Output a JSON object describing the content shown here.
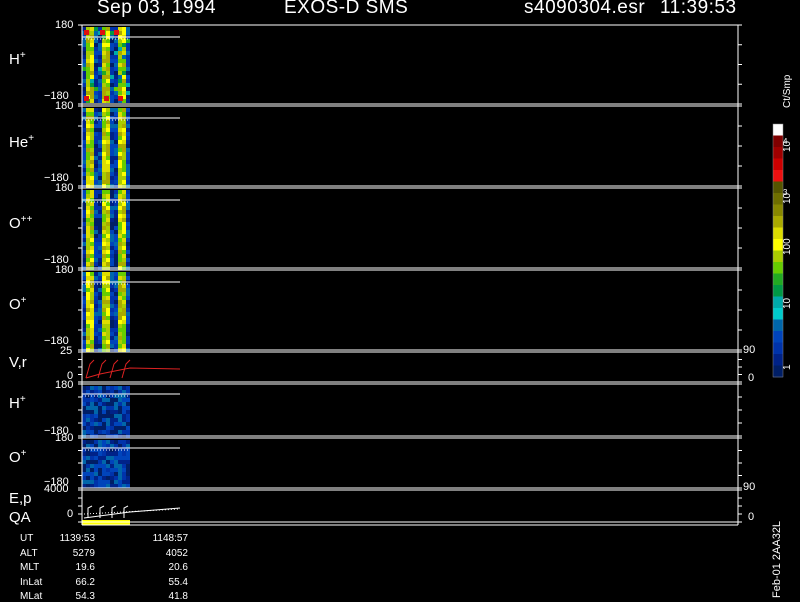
{
  "header": {
    "date": "Sep 03, 1994",
    "instrument": "EXOS-D SMS",
    "file": "s4090304.esr",
    "time": "11:39:53"
  },
  "panels": [
    {
      "label": "H",
      "sup": "+",
      "top": "180",
      "bottom": "−180"
    },
    {
      "label": "He",
      "sup": "+",
      "top": "180",
      "bottom": "−180"
    },
    {
      "label": "O",
      "sup": "++",
      "top": "180",
      "bottom": "−180"
    },
    {
      "label": "O",
      "sup": "+",
      "top": "180",
      "bottom": "−180"
    },
    {
      "label": "V,r",
      "sup": "",
      "top": "25",
      "bottom": "0",
      "right_top": "90",
      "right_bottom": "0"
    },
    {
      "label": "H",
      "sup": "+",
      "top": "180",
      "bottom": "−180"
    },
    {
      "label": "O",
      "sup": "+",
      "top": "180",
      "bottom": "−180"
    },
    {
      "label": "E,p",
      "sup": "",
      "label2": "QA",
      "top": "4000",
      "bottom": "0",
      "right_top": "90",
      "right_bottom": "0"
    }
  ],
  "colorbar": {
    "unit": "Ct/Smp",
    "labels": [
      "10",
      "4",
      "10",
      "3",
      "100",
      "10",
      "1"
    ],
    "colors": [
      "#ffffff",
      "#800000",
      "#a00000",
      "#cc0000",
      "#ee1010",
      "#555500",
      "#6e6e00",
      "#888800",
      "#aaaa00",
      "#dddd00",
      "#ffff00",
      "#aacc00",
      "#66cc00",
      "#22aa22",
      "#009944",
      "#00aaaa",
      "#00cccc",
      "#0066aa",
      "#0044bb",
      "#0033aa",
      "#002288",
      "#001e66"
    ]
  },
  "table": {
    "rows": [
      {
        "name": "UT",
        "v1": "1139:53",
        "v2": "1148:57"
      },
      {
        "name": "ALT",
        "v1": "5279",
        "v2": "4052"
      },
      {
        "name": "MLT",
        "v1": "19.6",
        "v2": "20.6"
      },
      {
        "name": "InLat",
        "v1": "66.2",
        "v2": "55.4"
      },
      {
        "name": "MLat",
        "v1": "54.3",
        "v2": "41.8"
      }
    ]
  },
  "side_label": "Feb-01 2AA32L",
  "chart_data": {
    "type": "heatmap",
    "title": "Sep 03, 1994   EXOS-D SMS",
    "panels": [
      {
        "name": "H+",
        "ylim": [
          -180,
          180
        ]
      },
      {
        "name": "He+",
        "ylim": [
          -180,
          180
        ]
      },
      {
        "name": "O++",
        "ylim": [
          -180,
          180
        ]
      },
      {
        "name": "O+",
        "ylim": [
          -180,
          180
        ]
      },
      {
        "name": "V,r",
        "ylim": [
          0,
          25
        ],
        "y2lim": [
          0,
          90
        ]
      },
      {
        "name": "H+",
        "ylim": [
          -180,
          180
        ]
      },
      {
        "name": "O+",
        "ylim": [
          -180,
          180
        ]
      },
      {
        "name": "E,p QA",
        "ylim": [
          0,
          4000
        ],
        "y2lim": [
          0,
          90
        ]
      }
    ],
    "x_range": [
      "1139:53",
      "1148:57"
    ],
    "colorbar": {
      "unit": "Ct/Smp",
      "ticks": [
        1,
        10,
        100,
        1000,
        10000
      ],
      "scale": "log"
    }
  }
}
